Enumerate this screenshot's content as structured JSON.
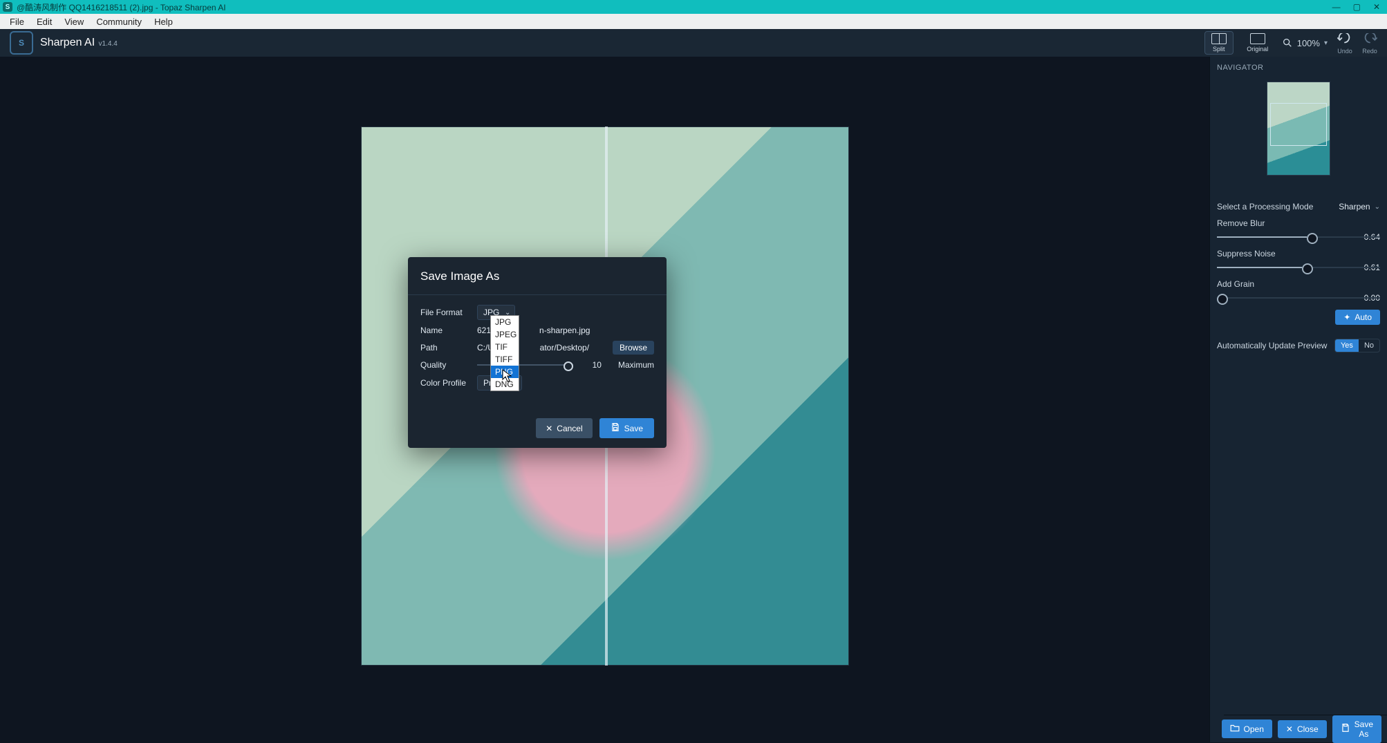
{
  "window": {
    "title": "@酷涛风制作 QQ1416218511 (2).jpg - Topaz Sharpen AI"
  },
  "menubar": {
    "items": [
      "File",
      "Edit",
      "View",
      "Community",
      "Help"
    ]
  },
  "app": {
    "name": "Sharpen AI",
    "version": "v1.4.4"
  },
  "toolbar": {
    "view_split": "Split",
    "view_original": "Original",
    "zoom": "100%",
    "undo": "Undo",
    "redo": "Redo"
  },
  "side": {
    "navigator": "NAVIGATOR",
    "mode_label": "Select a Processing Mode",
    "mode_value": "Sharpen",
    "remove_blur_label": "Remove Blur",
    "remove_blur_value": "0.64",
    "suppress_noise_label": "Suppress Noise",
    "suppress_noise_value": "0.61",
    "add_grain_label": "Add Grain",
    "add_grain_value": "0.00",
    "auto_label": "Auto",
    "auto_preview_label": "Automatically Update Preview",
    "auto_preview_yes": "Yes",
    "auto_preview_no": "No",
    "open": "Open",
    "close": "Close",
    "save_as": "Save As"
  },
  "dialog": {
    "title": "Save Image As",
    "file_format_label": "File Format",
    "file_format_value": "JPG",
    "name_label": "Name",
    "name_value": "621851",
    "name_suffix": "n-sharpen.jpg",
    "path_label": "Path",
    "path_value_left": "C:/User",
    "path_value_right": "ator/Desktop/",
    "browse": "Browse",
    "quality_label": "Quality",
    "quality_num": "10",
    "quality_word": "Maximum",
    "color_profile_label": "Color Profile",
    "color_profile_value": "ProPh",
    "cancel": "Cancel",
    "save": "Save",
    "options": [
      "JPG",
      "JPEG",
      "TIF",
      "TIFF",
      "PNG",
      "DNG"
    ],
    "highlight_index": 4
  }
}
